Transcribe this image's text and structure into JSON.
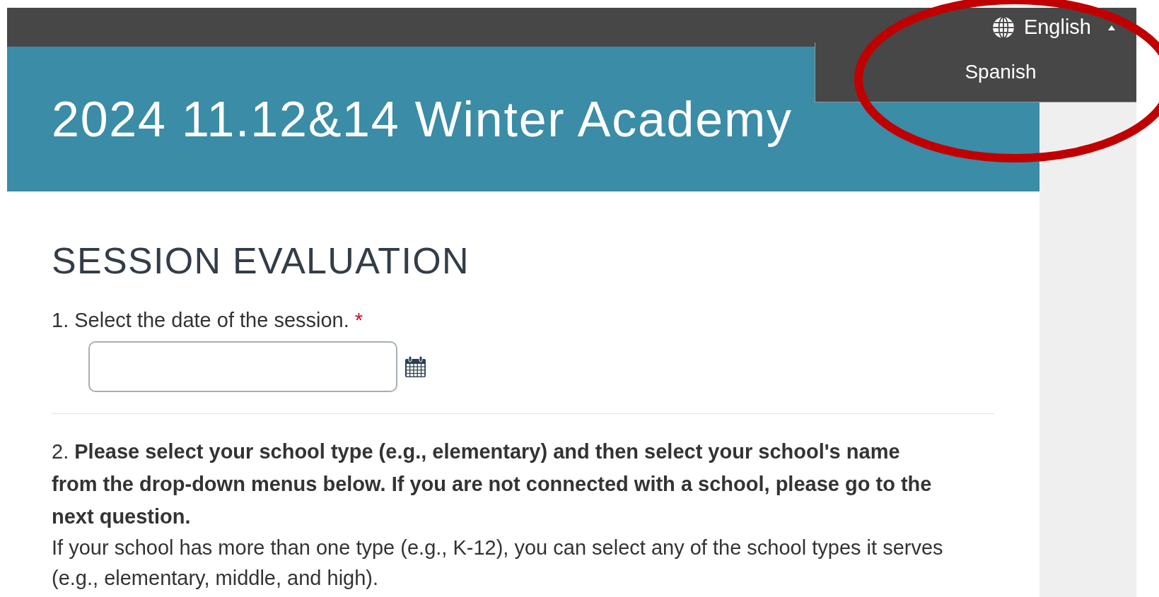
{
  "language_menu": {
    "current": "English",
    "expanded": true,
    "options": [
      {
        "label": "Spanish"
      }
    ]
  },
  "header": {
    "title": "2024 11.12&14 Winter Academy"
  },
  "form": {
    "title": "SESSION EVALUATION",
    "questions": [
      {
        "kind": "date",
        "number": "1.",
        "text": "Select the date of the session.",
        "required": true,
        "required_mark": "*"
      },
      {
        "kind": "info",
        "number": "2.",
        "text": "**Please select your school type (e.g., elementary) and then select your school's name from the drop-down menus below. If you are not connected with a school, please go to the next question.**",
        "note": "If your school has more than one type (e.g., K-12), you can select any of the school types it serves (e.g., elementary, middle, and high)."
      }
    ]
  },
  "annotation": {
    "kind": "ellipse"
  }
}
